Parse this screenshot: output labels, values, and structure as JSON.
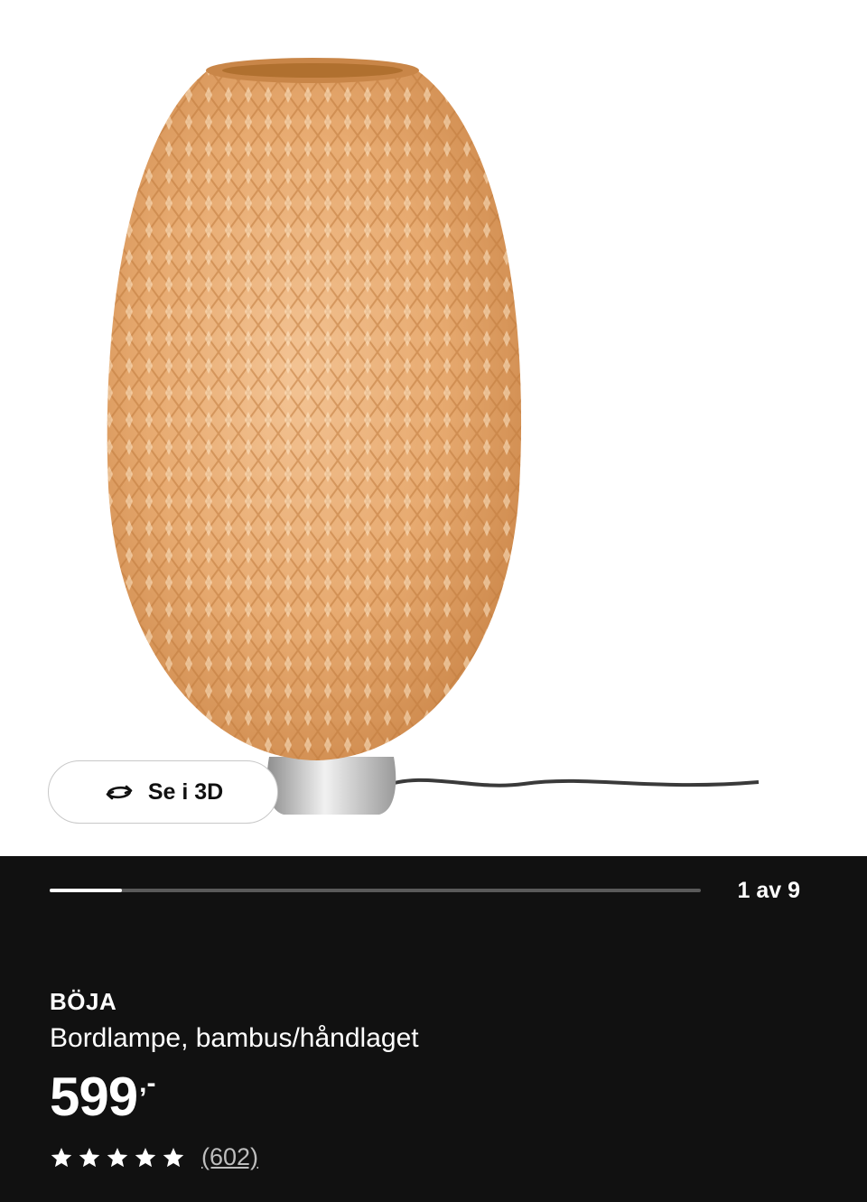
{
  "gallery": {
    "view3d_label": "Se i 3D",
    "current_index": 1,
    "total_images": 9,
    "counter_text": "1 av 9",
    "progress_fraction": 0.111
  },
  "product": {
    "name": "BÖJA",
    "description": "Bordlampe, bambus/håndlaget",
    "price_amount": "599",
    "price_suffix": ",-",
    "rating_stars": 5,
    "review_count_text": "(602)"
  },
  "icons": {
    "rotate": "rotate-3d-icon",
    "star": "star-icon"
  },
  "colors": {
    "background_dark": "#111111",
    "text_primary": "#ffffff",
    "text_secondary": "#bdbdbd",
    "bamboo": "#e2a66c"
  }
}
